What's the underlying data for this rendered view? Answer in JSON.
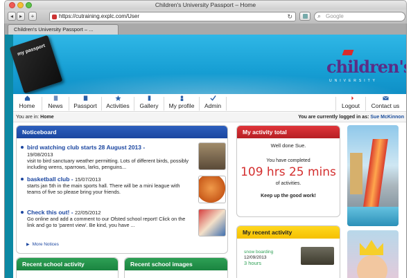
{
  "window": {
    "title": "Children's University Passport – Home",
    "url": "https://cutraining.explc.com/User",
    "search_placeholder": "Google",
    "tab_label": "Children's University Passport – ..."
  },
  "header": {
    "logo_text": "children's",
    "logo_sub": "UNIVERSITY",
    "book_text": "my passport"
  },
  "nav": {
    "items": [
      {
        "label": "Home",
        "icon": "home-icon"
      },
      {
        "label": "News",
        "icon": "news-icon"
      },
      {
        "label": "Passport",
        "icon": "passport-icon"
      },
      {
        "label": "Activities",
        "icon": "star-icon"
      },
      {
        "label": "Gallery",
        "icon": "gallery-icon"
      },
      {
        "label": "My profile",
        "icon": "person-icon"
      },
      {
        "label": "Admin",
        "icon": "checkmark-icon"
      }
    ],
    "right_items": [
      {
        "label": "Logout",
        "icon": "arrow-icon"
      },
      {
        "label": "Contact us",
        "icon": "envelope-icon"
      }
    ]
  },
  "breadcrumb": {
    "prefix": "You are in:",
    "current": "Home",
    "logged_in_text": "You are currently logged in as:",
    "user": "Sue McKinnon"
  },
  "noticeboard": {
    "title": "Noticeboard",
    "items": [
      {
        "title": "bird watching club starts 28 August 2013",
        "date": "19/08/2013",
        "body": "visit to bird sanctuary weather permitting. Lots of different birds, possibly including wrens, sparrows, larks, penguins..."
      },
      {
        "title": "basketball club",
        "date": "15/07/2013",
        "body": "starts jan 5th in the main sports hall. There will be a mini league with teams of five so please bring your friends."
      },
      {
        "title": "Check this out!",
        "date": "22/05/2012",
        "body": "Go online and add a comment to our Ofsted school report! Click on the link and go to 'parent view'. Be kind, you have ..."
      }
    ],
    "more_label": "More Notices"
  },
  "activity_total": {
    "title": "My activity total",
    "greeting": "Well done Sue.",
    "completed": "You have completed",
    "hours": "109 hrs 25 mins",
    "of_activities": "of activities.",
    "keep_up": "Keep up the good work!"
  },
  "recent_activity": {
    "title": "My recent activity",
    "name": "snow boarding",
    "date": "12/09/2013",
    "hours": "3 hours"
  },
  "school_activity": {
    "title": "Recent school activity"
  },
  "school_images": {
    "title": "Recent school images"
  },
  "colors": {
    "page_bg": "#0c88a3",
    "header_blue": "#179fd4",
    "noticeboard_blue": "#1b46a0",
    "activity_red": "#d42f2f",
    "recent_yellow": "#f5c000",
    "school_green": "#1a8440"
  }
}
